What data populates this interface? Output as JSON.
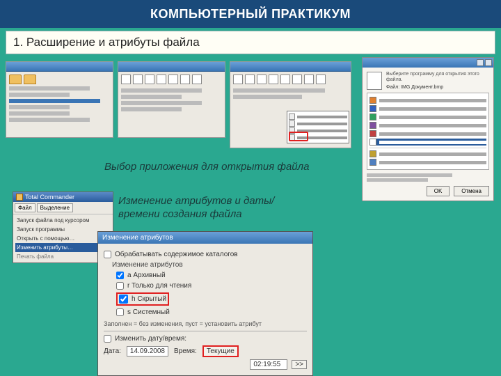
{
  "header": {
    "title": "КОМПЬЮТЕРНЫЙ ПРАКТИКУМ"
  },
  "task": {
    "text": "1. Расширение и атрибуты файла"
  },
  "caption1": "Выбор приложения для открытия файла",
  "caption2": "Изменение атрибутов и даты/времени создания файла",
  "tc": {
    "title": "Total Commander",
    "menu": {
      "item1": "Файл",
      "item2": "Выделение"
    },
    "items": {
      "i1": "Запуск файла под курсором",
      "i2": "Запуск программы",
      "i3": "Открыть с помощью…",
      "sel": "Изменить атрибуты…",
      "i5": "Печать файла"
    }
  },
  "attr": {
    "title": "Изменение атрибутов",
    "cb_process": "Обрабатывать содержимое каталогов",
    "group": "Изменение атрибутов",
    "a": "a  Архивный",
    "r": "r  Только для чтения",
    "h": "h  Скрытый",
    "s": "s  Системный",
    "note": "Заполнен = без изменения, пуст = установить атрибут",
    "cb_date": "Изменить дату/время:",
    "date_l": "Дата:",
    "date_v": "14.09.2008",
    "time_l": "Время:",
    "time_v": "02:19:55",
    "current_btn": "Текущие",
    "more_btn": ">>"
  },
  "openwith": {
    "head1": "Выберите программу для открытия этого файла.",
    "head2": "Файл:   IMG Документ.bmp",
    "ok": "OK",
    "cancel": "Отмена"
  }
}
